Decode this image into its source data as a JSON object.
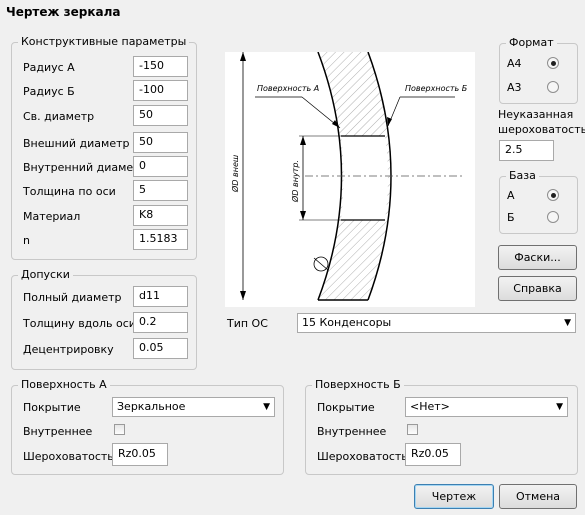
{
  "window": {
    "title": "Чертеж зеркала"
  },
  "design": {
    "legend": "Конструктивные параметры",
    "rows": [
      {
        "label": "Радиус А",
        "value": "-150"
      },
      {
        "label": "Радиус Б",
        "value": "-100"
      },
      {
        "label": "Св. диаметр",
        "value": "50"
      },
      {
        "label": "Внешний диаметр",
        "value": "50"
      },
      {
        "label": "Внутренний диаметр",
        "value": "0"
      },
      {
        "label": "Толщина по оси",
        "value": "5"
      },
      {
        "label": "Материал",
        "value": "K8"
      },
      {
        "label": "n",
        "value": "1.5183"
      }
    ]
  },
  "tolerances": {
    "legend": "Допуски",
    "rows": [
      {
        "label": "Полный диаметр",
        "value": "d11"
      },
      {
        "label": "Толщину вдоль оси",
        "value": "0.2"
      },
      {
        "label": "Децентрировку",
        "value": "0.05"
      }
    ]
  },
  "drawing": {
    "surface_a": "Поверхность А",
    "surface_b": "Поверхность Б",
    "outer_dim": "ØD внеш",
    "inner_dim": "ØD внутр."
  },
  "format": {
    "legend": "Формат",
    "options": [
      "А4",
      "А3"
    ],
    "selected": "А4"
  },
  "roughness": {
    "label_line1": "Неуказанная",
    "label_line2": "шероховатость",
    "value": "2.5"
  },
  "base": {
    "legend": "База",
    "options": [
      "А",
      "Б"
    ],
    "selected": "А"
  },
  "buttons": {
    "chamfers": "Фаски...",
    "help": "Справка",
    "draw": "Чертеж",
    "cancel": "Отмена"
  },
  "os_type": {
    "label": "Тип ОС",
    "value": "15 Конденсоры"
  },
  "surface_a": {
    "legend": "Поверхность А",
    "coating_label": "Покрытие",
    "coating_value": "Зеркальное",
    "inner_label": "Внутреннее",
    "inner_checked": false,
    "roughness_label": "Шероховатость",
    "roughness_value": "Rz0.05"
  },
  "surface_b": {
    "legend": "Поверхность Б",
    "coating_label": "Покрытие",
    "coating_value": "<Нет>",
    "inner_label": "Внутреннее",
    "inner_checked": false,
    "roughness_label": "Шероховатость",
    "roughness_value": "Rz0.05"
  }
}
